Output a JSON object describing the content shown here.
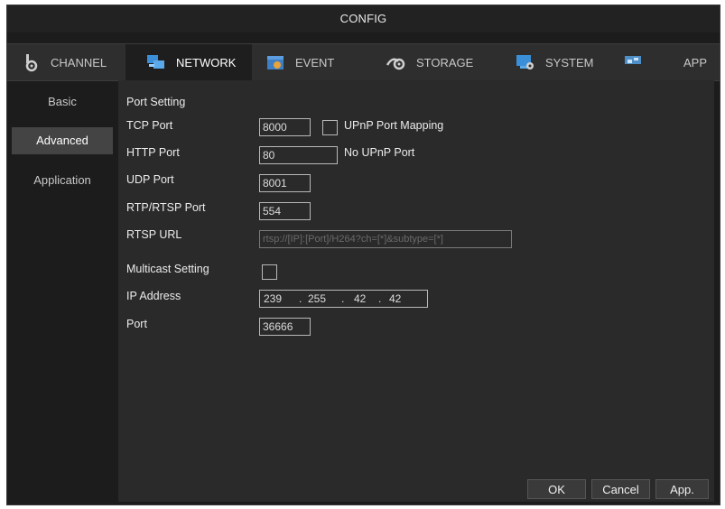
{
  "window": {
    "title": "CONFIG"
  },
  "tabs": [
    {
      "label": "CHANNEL",
      "icon": "channel-icon"
    },
    {
      "label": "NETWORK",
      "icon": "network-icon"
    },
    {
      "label": "EVENT",
      "icon": "event-icon"
    },
    {
      "label": "STORAGE",
      "icon": "storage-icon"
    },
    {
      "label": "SYSTEM",
      "icon": "system-icon"
    },
    {
      "label": "APP",
      "icon": "app-icon"
    }
  ],
  "active_tab": "NETWORK",
  "sidebar": {
    "items": [
      {
        "label": "Basic"
      },
      {
        "label": "Advanced"
      },
      {
        "label": "Application"
      }
    ],
    "active": "Advanced"
  },
  "port_setting": {
    "heading": "Port Setting",
    "tcp_port": {
      "label": "TCP Port",
      "value": "8000"
    },
    "upnp_mapping": {
      "label": "UPnP Port Mapping",
      "checked": false
    },
    "http_port": {
      "label": "HTTP Port",
      "value": "80"
    },
    "upnp_status": "No UPnP Port",
    "udp_port": {
      "label": "UDP Port",
      "value": "8001"
    },
    "rtsp_port": {
      "label": "RTP/RTSP Port",
      "value": "554"
    },
    "rtsp_url": {
      "label": "RTSP URL",
      "value": "rtsp://[IP]:[Port]/H264?ch=[*]&subtype=[*]"
    }
  },
  "multicast": {
    "label": "Multicast Setting",
    "checked": false,
    "ip_address": {
      "label": "IP Address",
      "octets": [
        "239",
        "255",
        "42",
        "42"
      ]
    },
    "port": {
      "label": "Port",
      "value": "36666"
    }
  },
  "buttons": {
    "ok": "OK",
    "cancel": "Cancel",
    "apply": "App."
  }
}
